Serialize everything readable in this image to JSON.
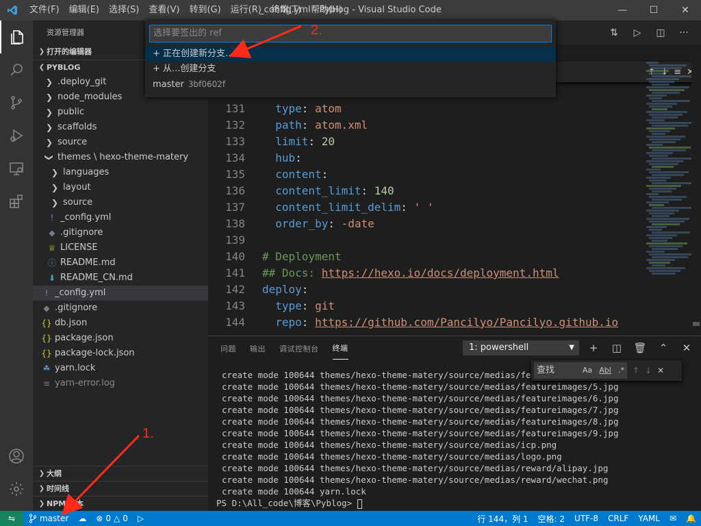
{
  "title_bar": {
    "logo": "vscode-logo",
    "menu": [
      "文件(F)",
      "编辑(E)",
      "选择(S)",
      "查看(V)",
      "转到(G)",
      "运行(R)",
      "终端(T)",
      "帮助(H)"
    ],
    "window_title": "_config.yml - Pyblog - Visual Studio Code",
    "controls": [
      "minimize",
      "maximize",
      "close"
    ]
  },
  "activity_bar": [
    "explorer-icon",
    "search-icon",
    "source-control-icon",
    "run-debug-icon",
    "remote-explorer-icon",
    "extensions-icon",
    "accounts-icon",
    "settings-gear-icon"
  ],
  "sidebar": {
    "title": "资源管理器",
    "open_editors": "打开的编辑器",
    "project": "PYBLOG",
    "tree": [
      {
        "label": ".deploy_git",
        "kind": "folder",
        "depth": 1
      },
      {
        "label": "node_modules",
        "kind": "folder",
        "depth": 1
      },
      {
        "label": "public",
        "kind": "folder",
        "depth": 1
      },
      {
        "label": "scaffolds",
        "kind": "folder",
        "depth": 1
      },
      {
        "label": "source",
        "kind": "folder",
        "depth": 1
      },
      {
        "label": "themes \\ hexo-theme-matery",
        "kind": "folder-open",
        "depth": 1
      },
      {
        "label": "languages",
        "kind": "folder",
        "depth": 2
      },
      {
        "label": "layout",
        "kind": "folder",
        "depth": 2
      },
      {
        "label": "source",
        "kind": "folder",
        "depth": 2
      },
      {
        "label": "_config.yml",
        "kind": "yml",
        "depth": 2
      },
      {
        "label": ".gitignore",
        "kind": "git",
        "depth": 2
      },
      {
        "label": "LICENSE",
        "kind": "license",
        "depth": 2
      },
      {
        "label": "README.md",
        "kind": "info",
        "depth": 2
      },
      {
        "label": "README_CN.md",
        "kind": "md",
        "depth": 2
      },
      {
        "label": "_config.yml",
        "kind": "yml",
        "depth": 1,
        "selected": true
      },
      {
        "label": ".gitignore",
        "kind": "git",
        "depth": 1
      },
      {
        "label": "db.json",
        "kind": "json",
        "depth": 1
      },
      {
        "label": "package.json",
        "kind": "json",
        "depth": 1
      },
      {
        "label": "package-lock.json",
        "kind": "json",
        "depth": 1
      },
      {
        "label": "yarn.lock",
        "kind": "yarn",
        "depth": 1
      },
      {
        "label": "yarn-error.log",
        "kind": "log",
        "depth": 1,
        "dim": true
      }
    ],
    "bottom_sections": [
      "大纲",
      "时间线",
      "NPM 脚本"
    ]
  },
  "editor": {
    "lines": [
      {
        "n": "131",
        "parts": [
          [
            "k",
            "  type"
          ],
          [
            "d",
            ": "
          ],
          [
            "s",
            "atom"
          ]
        ]
      },
      {
        "n": "132",
        "parts": [
          [
            "k",
            "  path"
          ],
          [
            "d",
            ": "
          ],
          [
            "s",
            "atom.xml"
          ]
        ]
      },
      {
        "n": "133",
        "parts": [
          [
            "k",
            "  limit"
          ],
          [
            "d",
            ": "
          ],
          [
            "n",
            "20"
          ]
        ]
      },
      {
        "n": "134",
        "parts": [
          [
            "k",
            "  hub"
          ],
          [
            "d",
            ":"
          ]
        ]
      },
      {
        "n": "135",
        "parts": [
          [
            "k",
            "  content"
          ],
          [
            "d",
            ":"
          ]
        ]
      },
      {
        "n": "136",
        "parts": [
          [
            "k",
            "  content_limit"
          ],
          [
            "d",
            ": "
          ],
          [
            "n",
            "140"
          ]
        ]
      },
      {
        "n": "137",
        "parts": [
          [
            "k",
            "  content_limit_delim"
          ],
          [
            "d",
            ": "
          ],
          [
            "s",
            "' '"
          ]
        ]
      },
      {
        "n": "138",
        "parts": [
          [
            "k",
            "  order_by"
          ],
          [
            "d",
            ": "
          ],
          [
            "s",
            "-date"
          ]
        ]
      },
      {
        "n": "139",
        "parts": []
      },
      {
        "n": "140",
        "parts": [
          [
            "c",
            "# Deployment"
          ]
        ]
      },
      {
        "n": "141",
        "parts": [
          [
            "c",
            "## Docs: "
          ],
          [
            "u",
            "https://hexo.io/docs/deployment.html"
          ]
        ]
      },
      {
        "n": "142",
        "parts": [
          [
            "k",
            "deploy"
          ],
          [
            "d",
            ":"
          ]
        ]
      },
      {
        "n": "143",
        "parts": [
          [
            "k",
            "  type"
          ],
          [
            "d",
            ": "
          ],
          [
            "s",
            "git"
          ]
        ]
      },
      {
        "n": "144",
        "parts": [
          [
            "k",
            "  repo"
          ],
          [
            "d",
            ": "
          ],
          [
            "u",
            "https://github.com/Pancilyo/Pancilyo.github.io"
          ]
        ]
      }
    ]
  },
  "panel": {
    "tabs": [
      "问题",
      "输出",
      "调试控制台",
      "终端"
    ],
    "active_tab": "终端",
    "terminal_select": "1: powershell",
    "find": {
      "placeholder": "查找",
      "opt_case": "Aa",
      "opt_word": "Abl",
      "opt_regex": ".*"
    },
    "terminal_lines": [
      "create mode 100644 themes/hexo-theme-matery/source/medias/featur",
      "create mode 100644 themes/hexo-theme-matery/source/medias/featureimages/5.jpg",
      "create mode 100644 themes/hexo-theme-matery/source/medias/featureimages/6.jpg",
      "create mode 100644 themes/hexo-theme-matery/source/medias/featureimages/7.jpg",
      "create mode 100644 themes/hexo-theme-matery/source/medias/featureimages/8.jpg",
      "create mode 100644 themes/hexo-theme-matery/source/medias/featureimages/9.jpg",
      "create mode 100644 themes/hexo-theme-matery/source/medias/icp.png",
      "create mode 100644 themes/hexo-theme-matery/source/medias/logo.png",
      "create mode 100644 themes/hexo-theme-matery/source/medias/reward/alipay.jpg",
      "create mode 100644 themes/hexo-theme-matery/source/medias/reward/wechat.png",
      "create mode 100644 yarn.lock"
    ],
    "prompt": "PS D:\\All_code\\博客\\Pyblog> "
  },
  "quick_pick": {
    "placeholder": "选择要签出的 ref",
    "items": [
      {
        "label": "+ 正在创建新分支...",
        "desc": "",
        "focused": true
      },
      {
        "label": "+ 从...创建分支",
        "desc": ""
      },
      {
        "label": "master",
        "desc": "3bf0602f"
      }
    ]
  },
  "status_bar": {
    "branch": "master",
    "errors": "0",
    "warnings": "0",
    "position": "行 144，列 1",
    "spaces": "空格: 2",
    "encoding": "UTF-8",
    "eol": "CRLF",
    "language": "YAML",
    "accent": "#007acc",
    "remote_color": "#16825d"
  },
  "annotations": {
    "step1": "1.",
    "step2": "2.",
    "color": "#ff2a1a"
  }
}
